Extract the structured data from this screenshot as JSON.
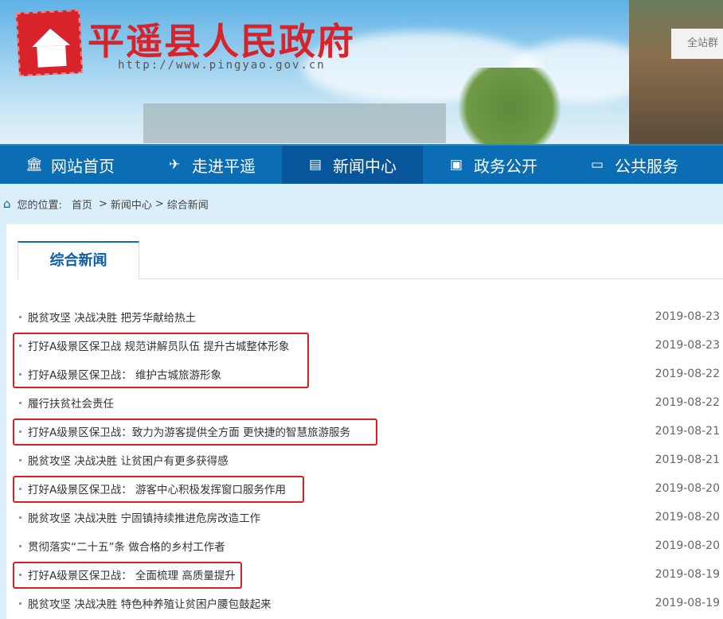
{
  "header": {
    "site_title": "平遥县人民政府",
    "url": "http://www.pingyao.gov.cn",
    "search_label": "全站群"
  },
  "nav": [
    {
      "label": "网站首页",
      "icon": "bank-icon"
    },
    {
      "label": "走进平遥",
      "icon": "map-icon"
    },
    {
      "label": "新闻中心",
      "icon": "newspaper-icon",
      "active": true
    },
    {
      "label": "政务公开",
      "icon": "document-icon"
    },
    {
      "label": "公共服务",
      "icon": "monitor-icon"
    }
  ],
  "breadcrumb": {
    "prefix": "您的位置:",
    "items": [
      "首页",
      ">",
      "新闻中心",
      ">",
      "综合新闻"
    ]
  },
  "tab": {
    "label": "综合新闻"
  },
  "news": [
    {
      "title": "脱贫攻坚 决战决胜 把芳华献给热土",
      "date": "2019-08-23"
    },
    {
      "title": "打好A级景区保卫战 规范讲解员队伍 提升古城整体形象",
      "date": "2019-08-23"
    },
    {
      "title": "打好A级景区保卫战： 维护古城旅游形象",
      "date": "2019-08-22"
    },
    {
      "title": "履行扶贫社会责任",
      "date": "2019-08-22"
    },
    {
      "title": "打好A级景区保卫战：致力为游客提供全方面 更快捷的智慧旅游服务",
      "date": "2019-08-21"
    },
    {
      "title": "脱贫攻坚 决战决胜 让贫困户有更多获得感",
      "date": "2019-08-21"
    },
    {
      "title": "打好A级景区保卫战： 游客中心积极发挥窗口服务作用",
      "date": "2019-08-20"
    },
    {
      "title": "脱贫攻坚 决战决胜 宁固镇持续推进危房改造工作",
      "date": "2019-08-20"
    },
    {
      "title": "贯彻落实“二十五”条 做合格的乡村工作者",
      "date": "2019-08-20"
    },
    {
      "title": "打好A级景区保卫战： 全面梳理 高质量提升",
      "date": "2019-08-19"
    },
    {
      "title": "脱贫攻坚 决战决胜 特色种养殖让贫困户腰包鼓起来",
      "date": "2019-08-19"
    }
  ],
  "colors": {
    "nav": "#0b6db4",
    "nav_active": "#07559a",
    "highlight": "#d82020",
    "title": "#d8232a"
  }
}
